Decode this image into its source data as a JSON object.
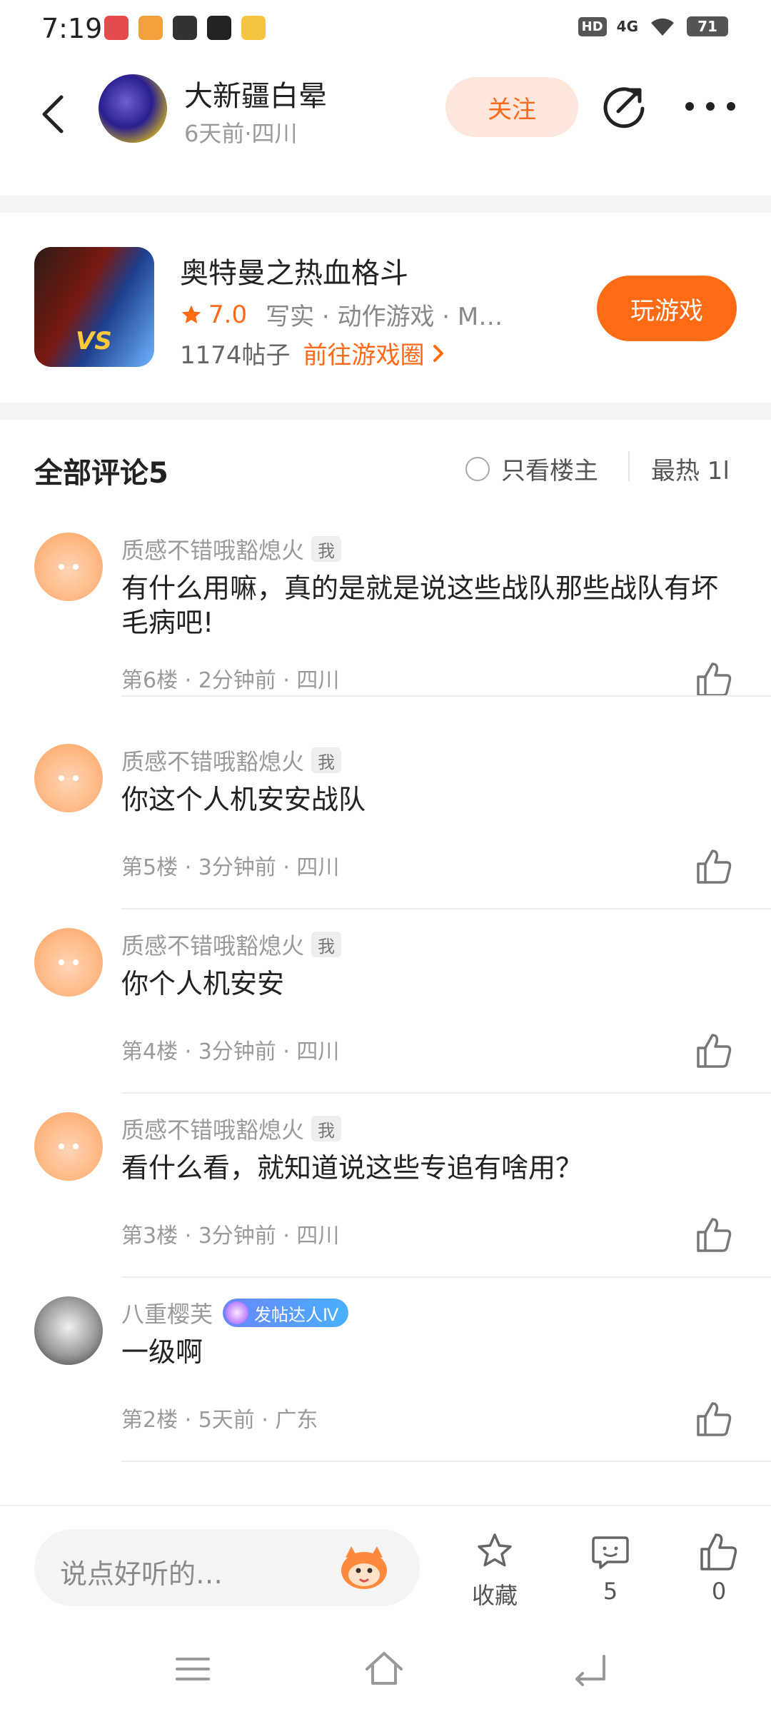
{
  "status": {
    "time": "7:19",
    "hd": "HD",
    "network": "4G",
    "battery": "71",
    "app_colors": [
      "#e54b4b",
      "#f2a03c",
      "#333333",
      "#222222",
      "#f5c542"
    ]
  },
  "header": {
    "author_name": "大新疆白晕",
    "author_meta": "6天前·四川",
    "follow_label": "关注"
  },
  "game": {
    "title": "奥特曼之热血格斗",
    "rating": "7.0",
    "tags": "写实 · 动作游戏 · M…",
    "posts": "1174帖子",
    "goto_label": "前往游戏圈",
    "play_label": "玩游戏",
    "icon_text": "VS"
  },
  "comments_header": {
    "title": "全部评论5",
    "only_author_label": "只看楼主",
    "sort_label": "最热 1l"
  },
  "comments": [
    {
      "name": "质感不错哦豁熄火",
      "badge": "我",
      "text": "有什么用嘛，真的是就是说这些战队那些战队有坏毛病吧!",
      "meta": "第6楼 · 2分钟前 · 四川"
    },
    {
      "name": "质感不错哦豁熄火",
      "badge": "我",
      "text": "你这个人机安安战队",
      "meta": "第5楼 · 3分钟前 · 四川"
    },
    {
      "name": "质感不错哦豁熄火",
      "badge": "我",
      "text": "你个人机安安",
      "meta": "第4楼 · 3分钟前 · 四川"
    },
    {
      "name": "质感不错哦豁熄火",
      "badge": "我",
      "text": "看什么看，就知道说这些专追有啥用？",
      "meta": "第3楼 · 3分钟前 · 四川"
    },
    {
      "name": "八重樱芙",
      "badge": "发帖达人Ⅳ",
      "text": "一级啊",
      "meta": "第2楼 · 5天前 · 广东"
    }
  ],
  "bottom": {
    "input_placeholder": "说点好听的…",
    "collect_label": "收藏",
    "comment_count": "5",
    "like_count": "0"
  },
  "colors": {
    "accent": "#ff6a14",
    "follow_bg": "#fde7dc",
    "muted": "#9a9a9a"
  }
}
